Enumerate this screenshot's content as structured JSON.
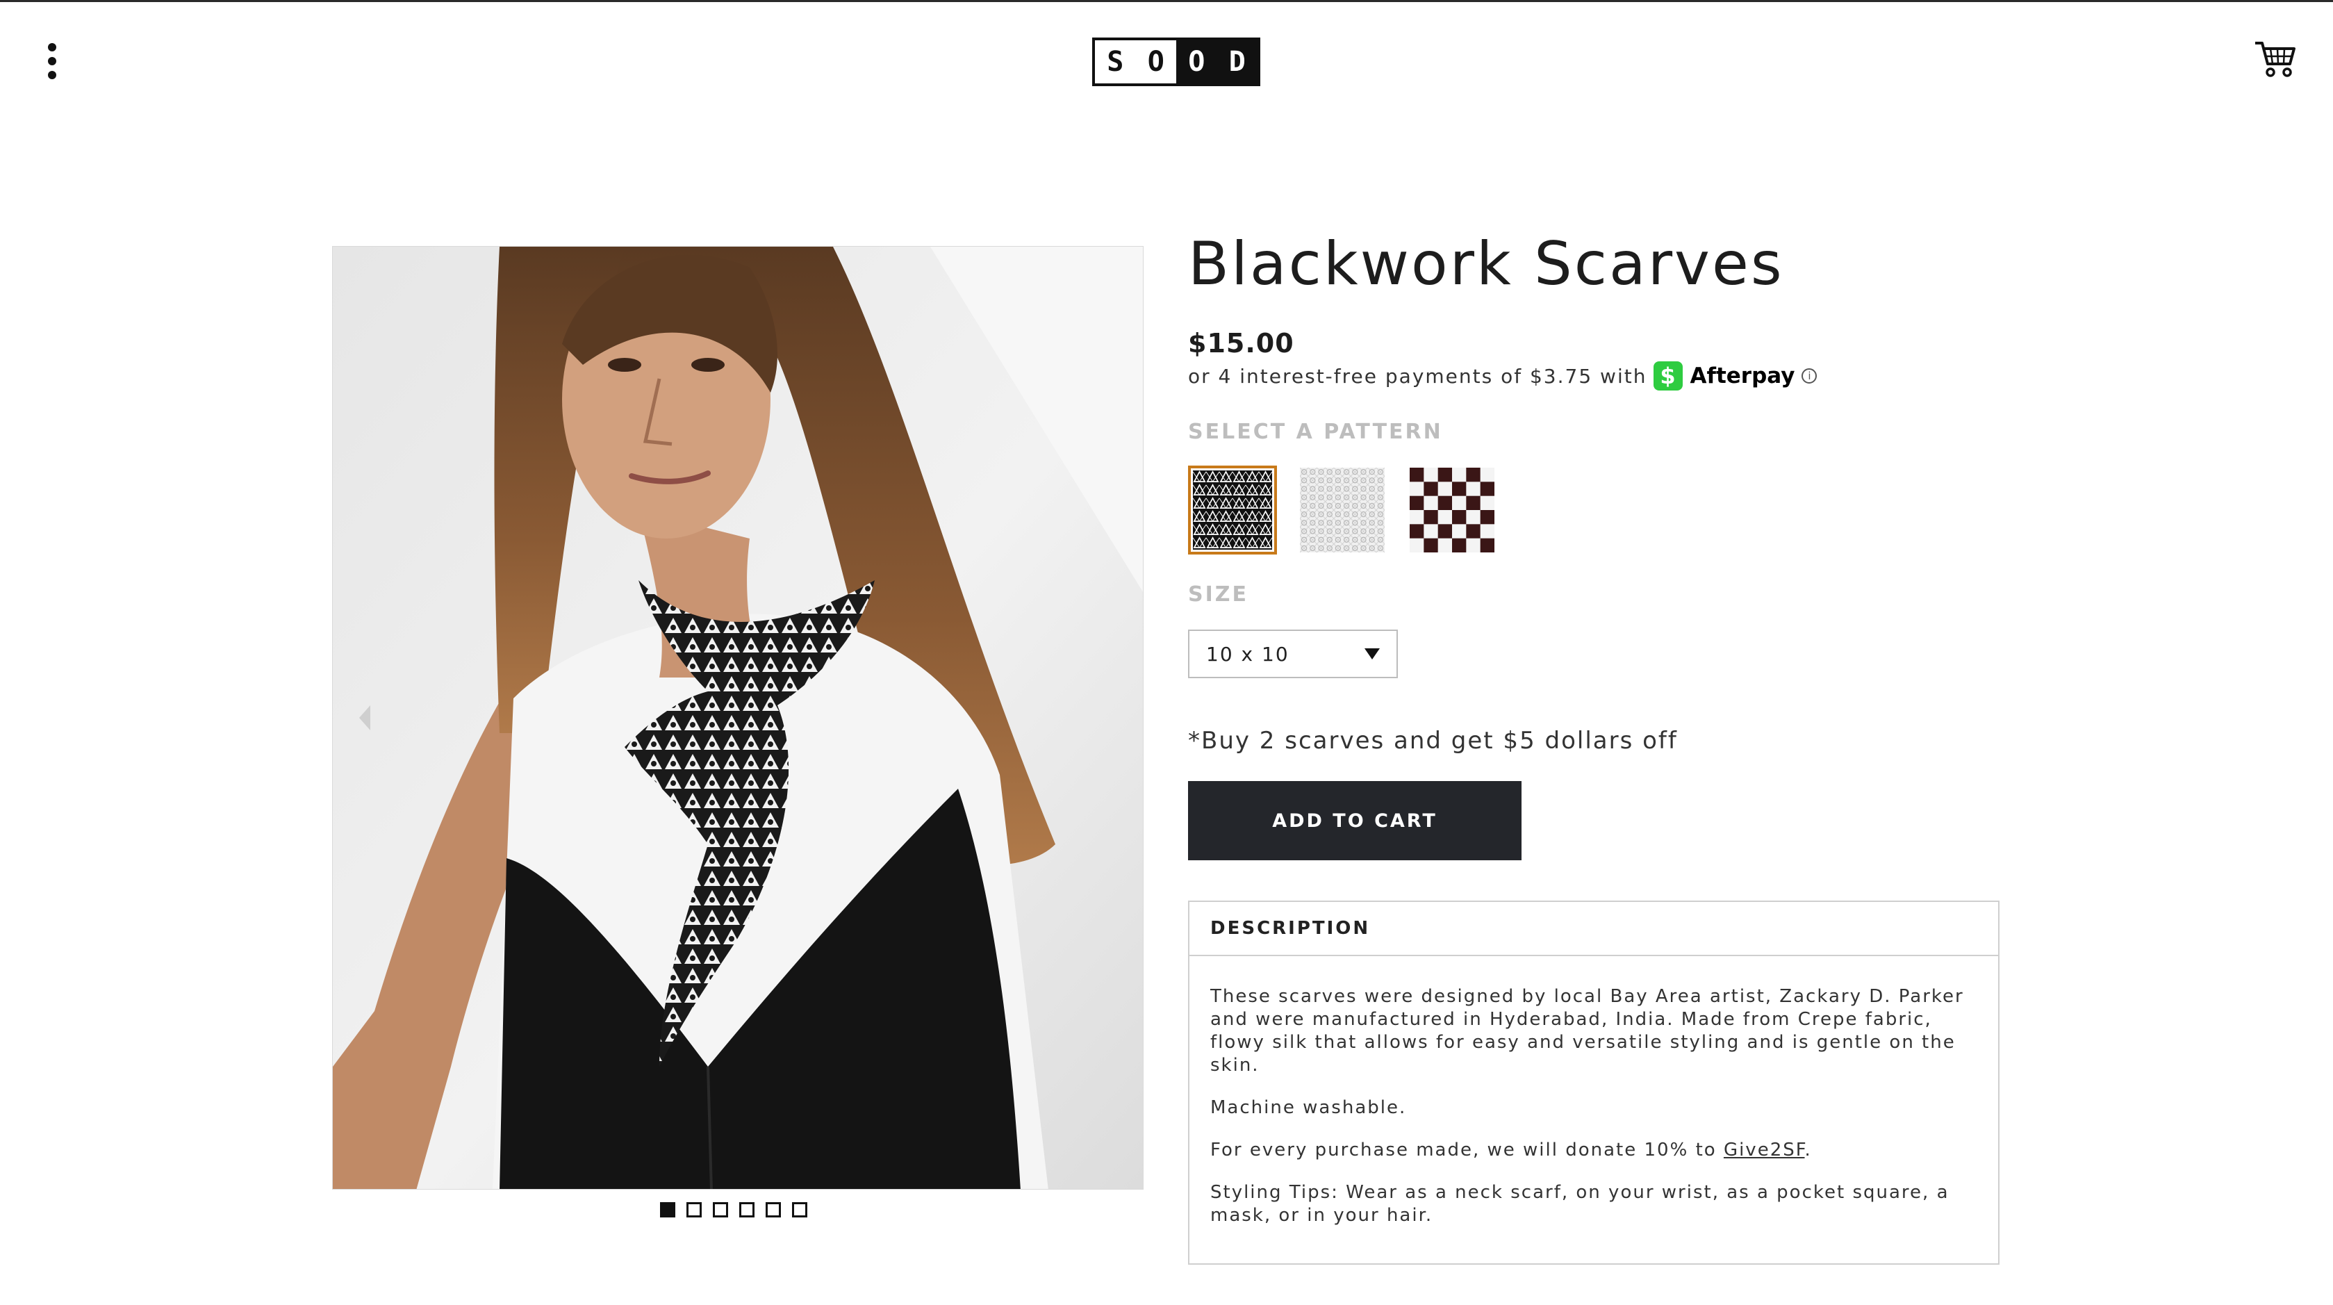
{
  "header": {
    "logo_letters": [
      "S",
      "O",
      "O",
      "D"
    ],
    "menu_icon": "vertical-dots-icon",
    "cart_icon": "cart-icon"
  },
  "product": {
    "title": "Blackwork Scarves",
    "price": "$15.00",
    "afterpay": {
      "text": "or 4 interest-free payments of $3.75 with",
      "badge_symbol": "$",
      "brand": "Afterpay",
      "badge_color": "#2ecc40"
    },
    "pattern_label": "SELECT A PATTERN",
    "patterns": [
      {
        "name": "triangle-star-pattern",
        "selected": true
      },
      {
        "name": "light-geometric-pattern",
        "selected": false
      },
      {
        "name": "checkerboard-pattern",
        "selected": false
      }
    ],
    "size_label": "SIZE",
    "size_value": "10 x 10",
    "promo": "*Buy 2 scarves and get $5 dollars off",
    "add_to_cart": "ADD TO CART"
  },
  "gallery": {
    "image_count": 6,
    "active_index": 0
  },
  "description": {
    "header": "DESCRIPTION",
    "paragraph_1": "These scarves were designed by local Bay Area artist, Zackary D. Parker and were manufactured in Hyderabad, India. Made from Crepe fabric, flowy silk that allows for easy and versatile styling and is gentle on the skin.",
    "paragraph_2": "Machine washable.",
    "paragraph_3_prefix": "For every purchase made, we will donate 10% to ",
    "paragraph_3_link": "Give2SF",
    "paragraph_3_suffix": ".",
    "paragraph_4": "Styling Tips: Wear as a neck scarf, on your wrist, as a pocket square, a mask, or in your hair."
  },
  "colors": {
    "accent_selected_border": "#c87a1a",
    "button_bg": "#24262b"
  }
}
